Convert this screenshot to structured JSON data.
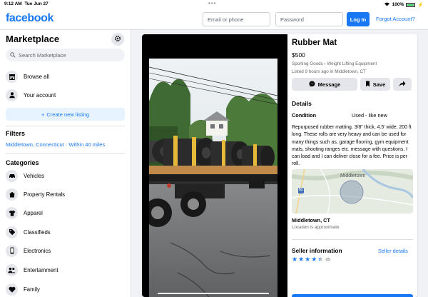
{
  "status_bar": {
    "time": "9:12 AM",
    "date": "Tue Jun 27",
    "battery": "100%"
  },
  "header": {
    "logo": "facebook",
    "email_placeholder": "Email or phone",
    "password_placeholder": "Password",
    "login_label": "Log In",
    "forgot_label": "Forgot Account?"
  },
  "sidebar": {
    "title": "Marketplace",
    "search_placeholder": "Search Marketplace",
    "browse_all": "Browse all",
    "your_account": "Your account",
    "create_listing": "Create new listing",
    "filters_title": "Filters",
    "location_filter": "Middletown, Connecticut · Within 40 miles",
    "categories_title": "Categories",
    "categories": [
      {
        "label": "Vehicles",
        "icon": "car-icon"
      },
      {
        "label": "Property Rentals",
        "icon": "house-icon"
      },
      {
        "label": "Apparel",
        "icon": "shirt-icon"
      },
      {
        "label": "Classifieds",
        "icon": "tag-icon"
      },
      {
        "label": "Electronics",
        "icon": "phone-icon"
      },
      {
        "label": "Entertainment",
        "icon": "people-icon"
      },
      {
        "label": "Family",
        "icon": "heart-icon"
      }
    ]
  },
  "listing": {
    "title": "Rubber Mat",
    "price": "$500",
    "breadcrumb": "Sporting Goods › Weight Lifting Equipment",
    "listed": "Listed 9 hours ago in Middletown, CT",
    "message_label": "Message",
    "save_label": "Save",
    "details_title": "Details",
    "condition_label": "Condition",
    "condition_value": "Used - like new",
    "description": "Repurposed rubber matting. 3/8\" thick, 4.5' wide, 200 ft long. These rolls are very heavy and can be used for many things such as, garage flooring, gym equipment mats, shooting ranges etc. message with questions, I can load and I can deliver close for a fee. Price is per roll.",
    "map_label": "Middletown",
    "map_route": "91",
    "location_city": "Middletown, CT",
    "location_note": "Location is approximate",
    "seller_title": "Seller information",
    "seller_details": "Seller details",
    "rating": 4.5,
    "rating_count": "(8)"
  }
}
